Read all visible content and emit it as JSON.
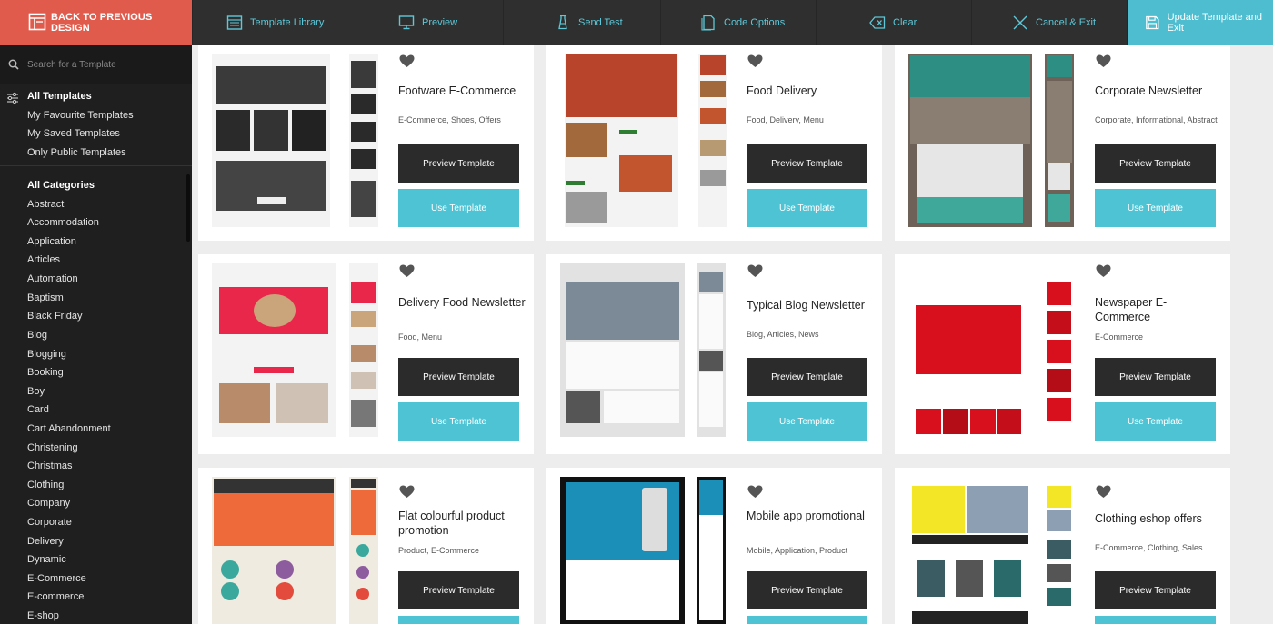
{
  "toolbar": {
    "back_label": "BACK TO PREVIOUS DESIGN",
    "template_library": "Template Library",
    "preview": "Preview",
    "send_test": "Send Test",
    "code_options": "Code Options",
    "clear": "Clear",
    "cancel_exit": "Cancel & Exit",
    "update_exit": "Update Template and Exit"
  },
  "sidebar": {
    "search_placeholder": "Search for a Template",
    "filters": [
      "All Templates",
      "My Favourite Templates",
      "My Saved Templates",
      "Only Public Templates"
    ],
    "categories": [
      "All Categories",
      "Abstract",
      "Accommodation",
      "Application",
      "Articles",
      "Automation",
      "Baptism",
      "Black Friday",
      "Blog",
      "Blogging",
      "Booking",
      "Boy",
      "Card",
      "Cart Abandonment",
      "Christening",
      "Christmas",
      "Clothing",
      "Company",
      "Corporate",
      "Delivery",
      "Dynamic",
      "E-Commerce",
      "E-commerce",
      "E-shop"
    ]
  },
  "buttons": {
    "preview_label": "Preview Template",
    "use_label": "Use Template"
  },
  "templates": [
    {
      "title": "Footware E-Commerce",
      "tags": "E-Commerce, Shoes, Offers"
    },
    {
      "title": "Food Delivery",
      "tags": "Food, Delivery, Menu"
    },
    {
      "title": "Corporate Newsletter",
      "tags": "Corporate, Informational, Abstract"
    },
    {
      "title": "Delivery Food Newsletter",
      "tags": "Food, Menu"
    },
    {
      "title": "Typical Blog Newsletter",
      "tags": "Blog, Articles, News"
    },
    {
      "title": "Newspaper E-Commerce",
      "tags": "E-Commerce"
    },
    {
      "title": "Flat colourful product promotion",
      "tags": "Product, E-Commerce"
    },
    {
      "title": "Mobile app promotional",
      "tags": "Mobile, Application, Product"
    },
    {
      "title": "Clothing eshop offers",
      "tags": "E-Commerce, Clothing, Sales"
    }
  ],
  "colors": {
    "accent": "#4ec3d3",
    "back_button": "#e05b4b",
    "toolbar": "#2f2f2f",
    "sidebar": "#1f1f1f",
    "preview_button": "#2b2b2b"
  },
  "icons": {
    "back": "layout-icon",
    "template_library": "grid-icon",
    "preview": "monitor-icon",
    "send_test": "flask-icon",
    "code_options": "document-icon",
    "clear": "backspace-icon",
    "cancel_exit": "close-icon",
    "update_exit": "save-icon",
    "search": "search-icon",
    "filters": "sliders-icon",
    "favourite": "heart-icon"
  }
}
